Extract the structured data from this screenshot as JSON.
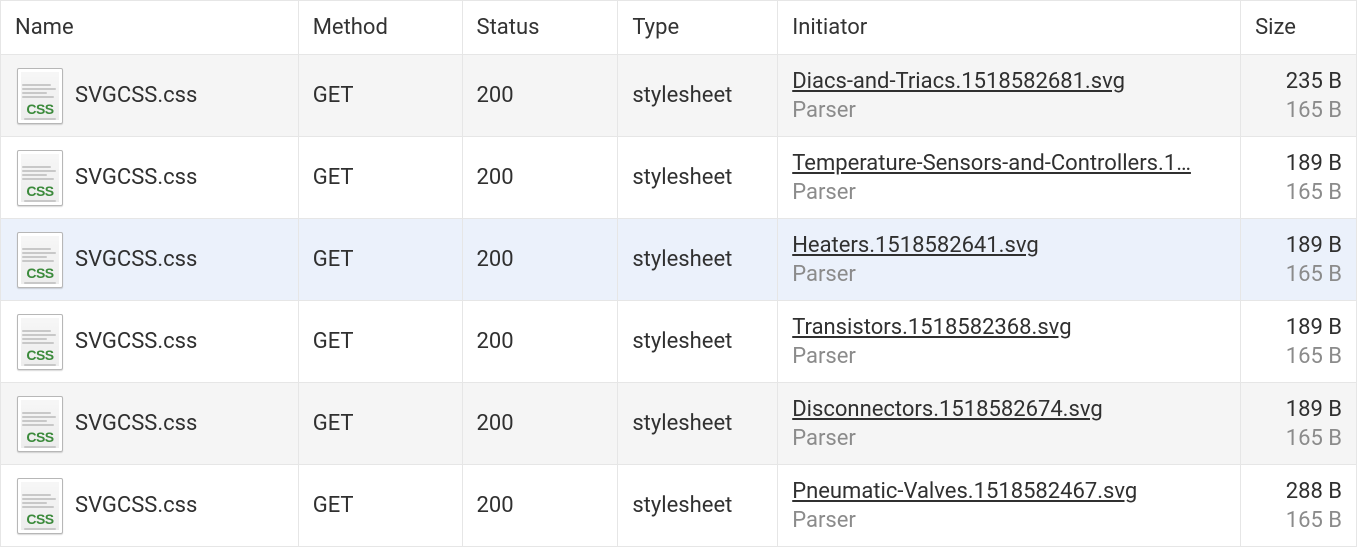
{
  "headers": {
    "name": "Name",
    "method": "Method",
    "status": "Status",
    "type": "Type",
    "initiator": "Initiator",
    "size": "Size"
  },
  "icon_label": "CSS",
  "rows": [
    {
      "name": "SVGCSS.css",
      "method": "GET",
      "status": "200",
      "type": "stylesheet",
      "initiator": "Diacs-and-Triacs.1518582681.svg",
      "initiator_sub": "Parser",
      "size": "235 B",
      "size_sub": "165 B",
      "row_class": "row-striped-a"
    },
    {
      "name": "SVGCSS.css",
      "method": "GET",
      "status": "200",
      "type": "stylesheet",
      "initiator": "Temperature-Sensors-and-Controllers.1…",
      "initiator_sub": "Parser",
      "size": "189 B",
      "size_sub": "165 B",
      "row_class": "row-striped-b"
    },
    {
      "name": "SVGCSS.css",
      "method": "GET",
      "status": "200",
      "type": "stylesheet",
      "initiator": "Heaters.1518582641.svg",
      "initiator_sub": "Parser",
      "size": "189 B",
      "size_sub": "165 B",
      "row_class": "row-selected"
    },
    {
      "name": "SVGCSS.css",
      "method": "GET",
      "status": "200",
      "type": "stylesheet",
      "initiator": "Transistors.1518582368.svg",
      "initiator_sub": "Parser",
      "size": "189 B",
      "size_sub": "165 B",
      "row_class": "row-striped-b"
    },
    {
      "name": "SVGCSS.css",
      "method": "GET",
      "status": "200",
      "type": "stylesheet",
      "initiator": "Disconnectors.1518582674.svg",
      "initiator_sub": "Parser",
      "size": "189 B",
      "size_sub": "165 B",
      "row_class": "row-striped-a"
    },
    {
      "name": "SVGCSS.css",
      "method": "GET",
      "status": "200",
      "type": "stylesheet",
      "initiator": "Pneumatic-Valves.1518582467.svg",
      "initiator_sub": "Parser",
      "size": "288 B",
      "size_sub": "165 B",
      "row_class": "row-striped-b"
    }
  ]
}
